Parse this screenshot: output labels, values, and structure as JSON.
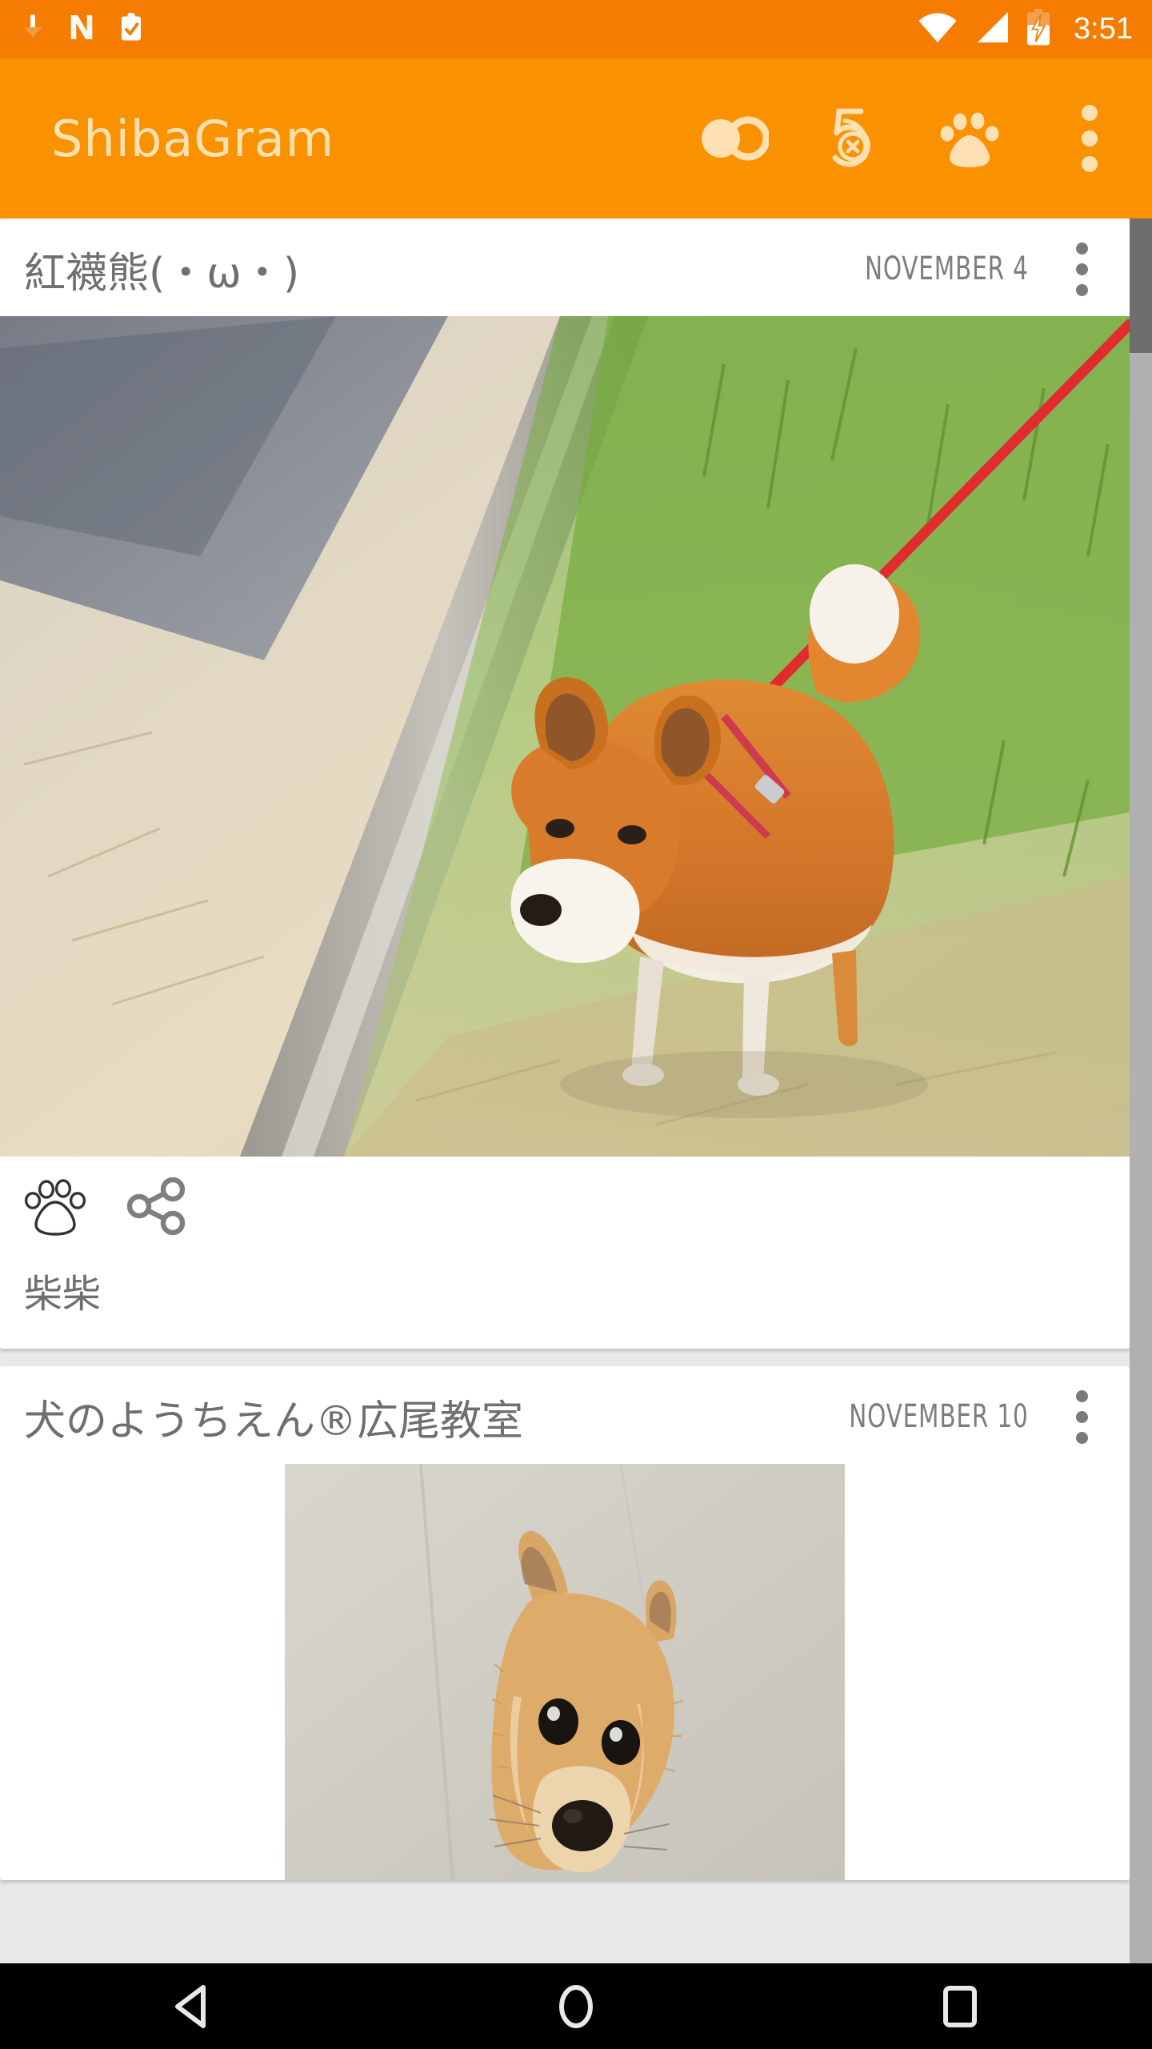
{
  "status_bar": {
    "background_color": "#f57c00",
    "left_icons": [
      {
        "name": "download-icon",
        "glyph": "download"
      },
      {
        "name": "nova-launcher-icon",
        "glyph": "N"
      },
      {
        "name": "tasks-clipboard-icon",
        "glyph": "clipboard-check"
      }
    ],
    "right_icons": [
      {
        "name": "wifi-icon",
        "glyph": "wifi"
      },
      {
        "name": "cellular-signal-icon",
        "glyph": "signal"
      },
      {
        "name": "battery-charging-icon",
        "glyph": "battery-charging"
      }
    ],
    "clock": "3:51"
  },
  "app_bar": {
    "background_color": "#fa9200",
    "title": "ShibaGram",
    "title_color": "#ffe0b2",
    "actions": [
      {
        "name": "theme-toggle-icon",
        "label": "Theme toggle"
      },
      {
        "name": "five-refresh-icon",
        "label": "Load 5"
      },
      {
        "name": "paw-icon",
        "label": "Favorites"
      },
      {
        "name": "overflow-menu-icon",
        "label": "More options"
      }
    ]
  },
  "feed": {
    "background_color": "#e9e9e9",
    "posts": [
      {
        "username": "紅襪熊(・ω・)",
        "date": "November 4",
        "overflow_label": "More options",
        "photo_alt": "Shiba Inu on red leash standing on grass beside a curb",
        "actions": [
          {
            "name": "paw-like-icon",
            "label": "Like"
          },
          {
            "name": "share-icon",
            "label": "Share"
          }
        ],
        "caption": "柴柴"
      },
      {
        "username": "犬のようちえん®広尾教室",
        "date": "November 10",
        "overflow_label": "More options",
        "photo_alt": "Shiba Inu puppy looking up at the camera on a tiled floor",
        "actions": [],
        "caption": ""
      }
    ]
  },
  "scrollbar": {
    "name": "feed-scrollbar",
    "thumb_color": "#6e6e6e",
    "track_color": "#b0b0b0"
  },
  "nav_bar": {
    "background_color": "#000000",
    "buttons": [
      {
        "name": "nav-back-button",
        "label": "Back"
      },
      {
        "name": "nav-home-button",
        "label": "Home"
      },
      {
        "name": "nav-recents-button",
        "label": "Recents"
      }
    ]
  },
  "colors": {
    "accent": "#fa9200",
    "status_bar": "#f57c00",
    "title_cream": "#ffe0b2",
    "text_gray": "#6f6f6f",
    "card_white": "#ffffff"
  }
}
